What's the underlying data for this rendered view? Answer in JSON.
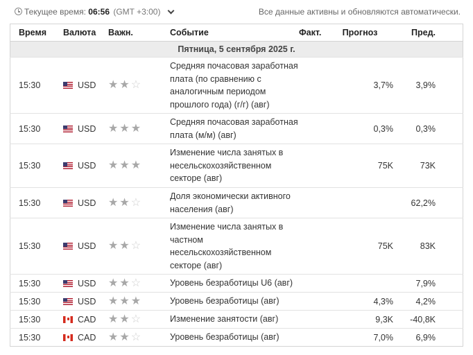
{
  "header": {
    "time_label": "Текущее время:",
    "time_value": "06:56",
    "timezone": "(GMT +3:00)",
    "auto_update_note": "Все данные активны и обновляются автоматически."
  },
  "table": {
    "columns": {
      "time": "Время",
      "currency": "Валюта",
      "importance": "Важн.",
      "event": "Событие",
      "actual": "Факт.",
      "forecast": "Прогноз",
      "previous": "Пред."
    },
    "date_label": "Пятница, 5 сентября 2025 г.",
    "rows": [
      {
        "time": "15:30",
        "flag": "us",
        "currency": "USD",
        "stars": "★★",
        "stars_off": "☆",
        "event": "Средняя почасовая заработная плата (по сравнению с аналогичным периодом прошлого года) (г/г) (авг)",
        "actual": "",
        "forecast": "3,7%",
        "previous": "3,9%",
        "height": 80
      },
      {
        "time": "15:30",
        "flag": "us",
        "currency": "USD",
        "stars": "★★★",
        "stars_off": "",
        "event": "Средняя почасовая заработная плата (м/м) (авг)",
        "actual": "",
        "forecast": "0,3%",
        "previous": "0,3%",
        "height": 43
      },
      {
        "time": "15:30",
        "flag": "us",
        "currency": "USD",
        "stars": "★★★",
        "stars_off": "",
        "event": "Изменение числа занятых в несельскохозяйственном секторе (авг)",
        "actual": "",
        "forecast": "75K",
        "previous": "73K",
        "height": 63
      },
      {
        "time": "15:30",
        "flag": "us",
        "currency": "USD",
        "stars": "★★",
        "stars_off": "☆",
        "event": "Доля экономически активного населения (авг)",
        "actual": "",
        "forecast": "",
        "previous": "62,2%",
        "height": 43
      },
      {
        "time": "15:30",
        "flag": "us",
        "currency": "USD",
        "stars": "★★",
        "stars_off": "☆",
        "event": "Изменение числа занятых в частном несельскохозяйственном секторе (авг)",
        "actual": "",
        "forecast": "75K",
        "previous": "83K",
        "height": 81
      },
      {
        "time": "15:30",
        "flag": "us",
        "currency": "USD",
        "stars": "★★",
        "stars_off": "☆",
        "event": "Уровень безработицы U6 (авг)",
        "actual": "",
        "forecast": "",
        "previous": "7,9%",
        "height": 26
      },
      {
        "time": "15:30",
        "flag": "us",
        "currency": "USD",
        "stars": "★★★",
        "stars_off": "",
        "event": "Уровень безработицы (авг)",
        "actual": "",
        "forecast": "4,3%",
        "previous": "4,2%",
        "height": 26
      },
      {
        "time": "15:30",
        "flag": "ca",
        "currency": "CAD",
        "stars": "★★",
        "stars_off": "☆",
        "event": "Изменение занятости (авг)",
        "actual": "",
        "forecast": "9,3K",
        "previous": "-40,8K",
        "height": 26
      },
      {
        "time": "15:30",
        "flag": "ca",
        "currency": "CAD",
        "stars": "★★",
        "stars_off": "☆",
        "event": "Уровень безработицы (авг)",
        "actual": "",
        "forecast": "7,0%",
        "previous": "6,9%",
        "height": 26
      }
    ]
  }
}
